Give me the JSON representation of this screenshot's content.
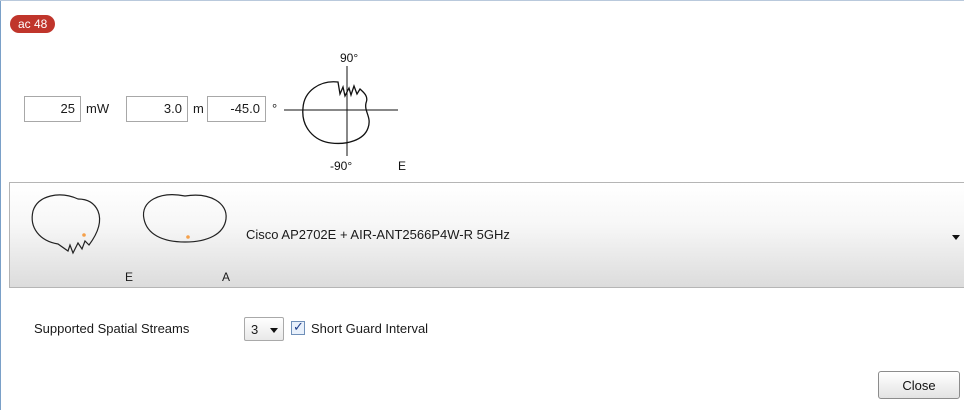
{
  "badge": {
    "text": "ac 48",
    "color": "#c0352b"
  },
  "settings": {
    "power": {
      "value": "25",
      "unit": "mW"
    },
    "height": {
      "value": "3.0",
      "unit": "m"
    },
    "tilt": {
      "value": "-45.0",
      "unit": "°"
    }
  },
  "pattern_plot": {
    "top_label": "90°",
    "bottom_label": "-90°",
    "plane_label": "E"
  },
  "antenna": {
    "name": "Cisco AP2702E + AIR-ANT2566P4W-R 5GHz",
    "e_plane_label": "E",
    "a_plane_label": "A",
    "dot_color": "#f5a04a"
  },
  "streams": {
    "label": "Supported Spatial Streams",
    "selected": "3"
  },
  "short_guard_interval": {
    "label": "Short Guard Interval",
    "checked": true
  },
  "close_button": {
    "label": "Close"
  }
}
